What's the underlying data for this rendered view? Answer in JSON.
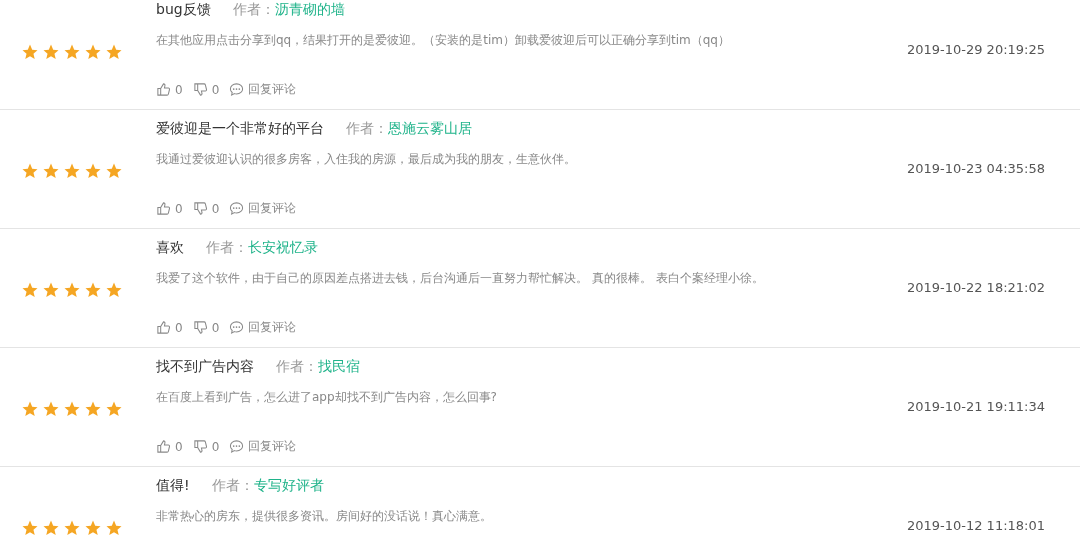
{
  "reviews": [
    {
      "stars": 5,
      "title": "bug反馈",
      "author_label": "作者：",
      "author": "沥青砌的墙",
      "text": "在其他应用点击分享到qq，结果打开的是爱彼迎。（安装的是tim）卸载爱彼迎后可以正确分享到tim（qq）",
      "likes": "0",
      "dislikes": "0",
      "reply": "回复评论",
      "date": "2019-10-29 20:19:25"
    },
    {
      "stars": 5,
      "title": "爱彼迎是一个非常好的平台",
      "author_label": "作者：",
      "author": "恩施云雾山居",
      "text": "我通过爱彼迎认识的很多房客，入住我的房源，最后成为我的朋友，生意伙伴。",
      "likes": "0",
      "dislikes": "0",
      "reply": "回复评论",
      "date": "2019-10-23 04:35:58"
    },
    {
      "stars": 5,
      "title": "喜欢",
      "author_label": "作者：",
      "author": "长安祝忆录",
      "text": "我爱了这个软件，由于自己的原因差点搭进去钱，后台沟通后一直努力帮忙解决。 真的很棒。 表白个案经理小徐。",
      "likes": "0",
      "dislikes": "0",
      "reply": "回复评论",
      "date": "2019-10-22 18:21:02"
    },
    {
      "stars": 5,
      "title": "找不到广告内容",
      "author_label": "作者：",
      "author": "找民宿",
      "text": "在百度上看到广告，怎么进了app却找不到广告内容，怎么回事?",
      "likes": "0",
      "dislikes": "0",
      "reply": "回复评论",
      "date": "2019-10-21 19:11:34"
    },
    {
      "stars": 5,
      "title": "值得!",
      "author_label": "作者：",
      "author": "专写好评者",
      "text": "非常热心的房东，提供很多资讯。房间好的没话说！真心满意。",
      "date": "2019-10-12 11:18:01"
    }
  ]
}
